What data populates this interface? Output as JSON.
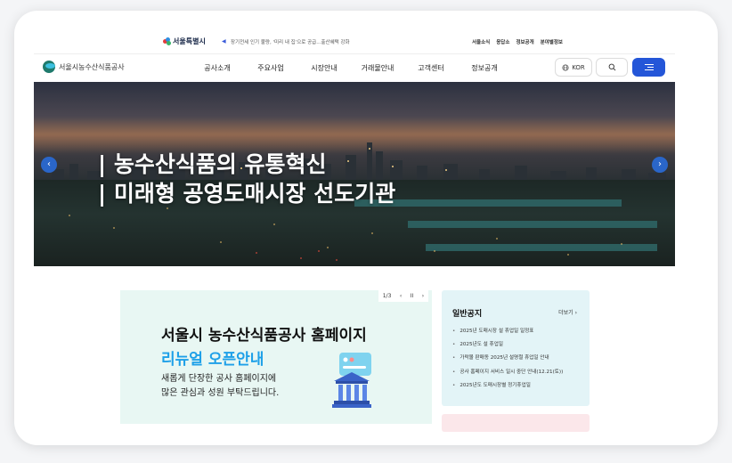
{
  "utility": {
    "seoul_logo": "서울특별시",
    "news": "장기전세 인기 불량, '미리 내 집'으로 공급...출산혜택 강화",
    "links": [
      "서울소식",
      "응답소",
      "정보공개",
      "분야별정보"
    ]
  },
  "header": {
    "brand": "서울시농수산식품공사",
    "nav": [
      "공사소개",
      "주요사업",
      "시장안내",
      "거래물안내",
      "고객센터",
      "정보공개"
    ],
    "lang_label": "KOR",
    "icons": {
      "globe": "globe-icon",
      "search": "search-icon",
      "menu": "menu-icon"
    }
  },
  "hero": {
    "line1": "| 농수산식품의 유통혁신",
    "line2": "| 미래형 공영도매시장 선도기관",
    "prev": "‹",
    "next": "›"
  },
  "popup": {
    "counter": "1/3",
    "prev": "‹",
    "pause": "II",
    "next": "›",
    "title": "서울시 농수산식품공사 홈페이지",
    "subtitle": "리뉴얼 오픈안내",
    "body_line1": "새롭게 단장한 공사 홈페이지에",
    "body_line2": "많은 관심과 성원 부탁드립니다."
  },
  "notice": {
    "title": "일반공지",
    "more": "더보기 ›",
    "items": [
      "2025년 도매시장 설 휴업일 일정표",
      "2025년도 설 휴업일",
      "가락몰 판매동 2025년 설명절 휴업일 안내",
      "공사 홈페이지 서비스 일시 중단 안내(12.21(토))",
      "2025년도 도매시장별 정기휴업일"
    ]
  },
  "colors": {
    "accent": "#2456d8",
    "popup_bg": "#e8f7f3",
    "notice_bg": "#e3f4f7",
    "subtitle": "#1ea0e8"
  }
}
